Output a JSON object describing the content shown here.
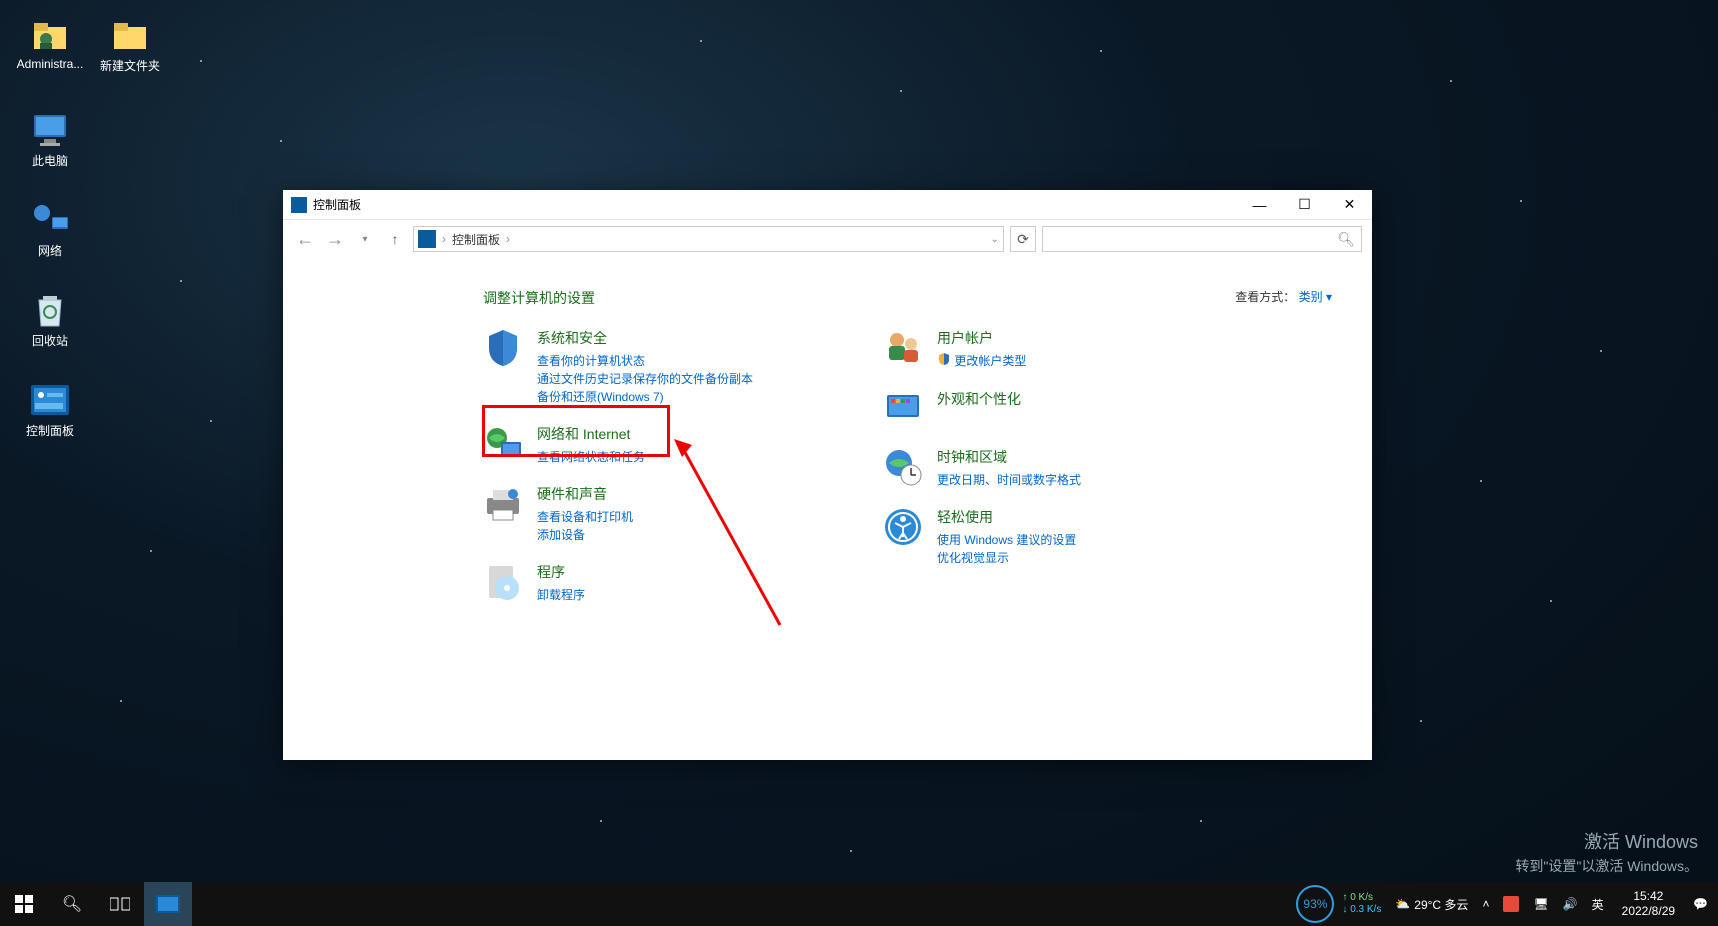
{
  "desktop": {
    "icons": [
      {
        "label": "Administra..."
      },
      {
        "label": "新建文件夹"
      },
      {
        "label": "此电脑"
      },
      {
        "label": "网络"
      },
      {
        "label": "回收站"
      },
      {
        "label": "控制面板"
      }
    ]
  },
  "window": {
    "title": "控制面板",
    "address": "控制面板",
    "heading": "调整计算机的设置",
    "viewby_label": "查看方式：",
    "viewby_value": "类别 ▾",
    "left_categories": [
      {
        "title": "系统和安全",
        "links": [
          "查看你的计算机状态",
          "通过文件历史记录保存你的文件备份副本",
          "备份和还原(Windows 7)"
        ]
      },
      {
        "title": "网络和 Internet",
        "links": [
          "查看网络状态和任务"
        ]
      },
      {
        "title": "硬件和声音",
        "links": [
          "查看设备和打印机",
          "添加设备"
        ]
      },
      {
        "title": "程序",
        "links": [
          "卸载程序"
        ]
      }
    ],
    "right_categories": [
      {
        "title": "用户帐户",
        "links": [
          "更改帐户类型"
        ],
        "badge": true
      },
      {
        "title": "外观和个性化",
        "links": []
      },
      {
        "title": "时钟和区域",
        "links": [
          "更改日期、时间或数字格式"
        ]
      },
      {
        "title": "轻松使用",
        "links": [
          "使用 Windows 建议的设置",
          "优化视觉显示"
        ]
      }
    ]
  },
  "taskbar": {
    "net_percent": "93%",
    "net_up": "0 K/s",
    "net_down": "0.3 K/s",
    "weather": "29°C 多云",
    "ime": "英",
    "time": "15:42",
    "date": "2022/8/29"
  },
  "watermark": {
    "line1": "激活 Windows",
    "line2": "转到\"设置\"以激活 Windows。"
  }
}
